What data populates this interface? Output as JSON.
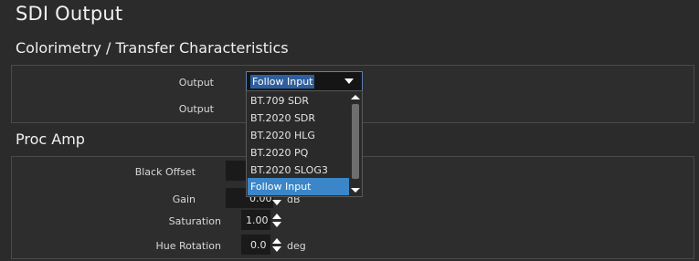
{
  "page": {
    "title": "SDI Output"
  },
  "colorimetry": {
    "section_title": "Colorimetry / Transfer Characteristics",
    "rows": [
      {
        "label": "Output",
        "value": "Follow Input"
      },
      {
        "label": "Output"
      }
    ],
    "dropdown": {
      "options": [
        "BT.709 SDR",
        "BT.2020 SDR",
        "BT.2020 HLG",
        "BT.2020 PQ",
        "BT.2020 SLOG3",
        "Follow Input"
      ],
      "selected_index": 5
    }
  },
  "proc_amp": {
    "section_title": "Proc Amp",
    "rows": [
      {
        "label": "Black Offset",
        "value": ""
      },
      {
        "label": "Gain",
        "value": "0.00",
        "unit": "dB"
      },
      {
        "label": "Saturation",
        "value": "1.00"
      },
      {
        "label": "Hue Rotation",
        "value": "0.0",
        "unit": "deg"
      }
    ]
  },
  "colors": {
    "background": "#2b2b2b",
    "accent_selection": "#3a86c8",
    "field_background": "#1a1a1a"
  },
  "icons": {
    "select_caret": "chevron-down-icon",
    "spinner": "up-down-arrows-icon"
  }
}
